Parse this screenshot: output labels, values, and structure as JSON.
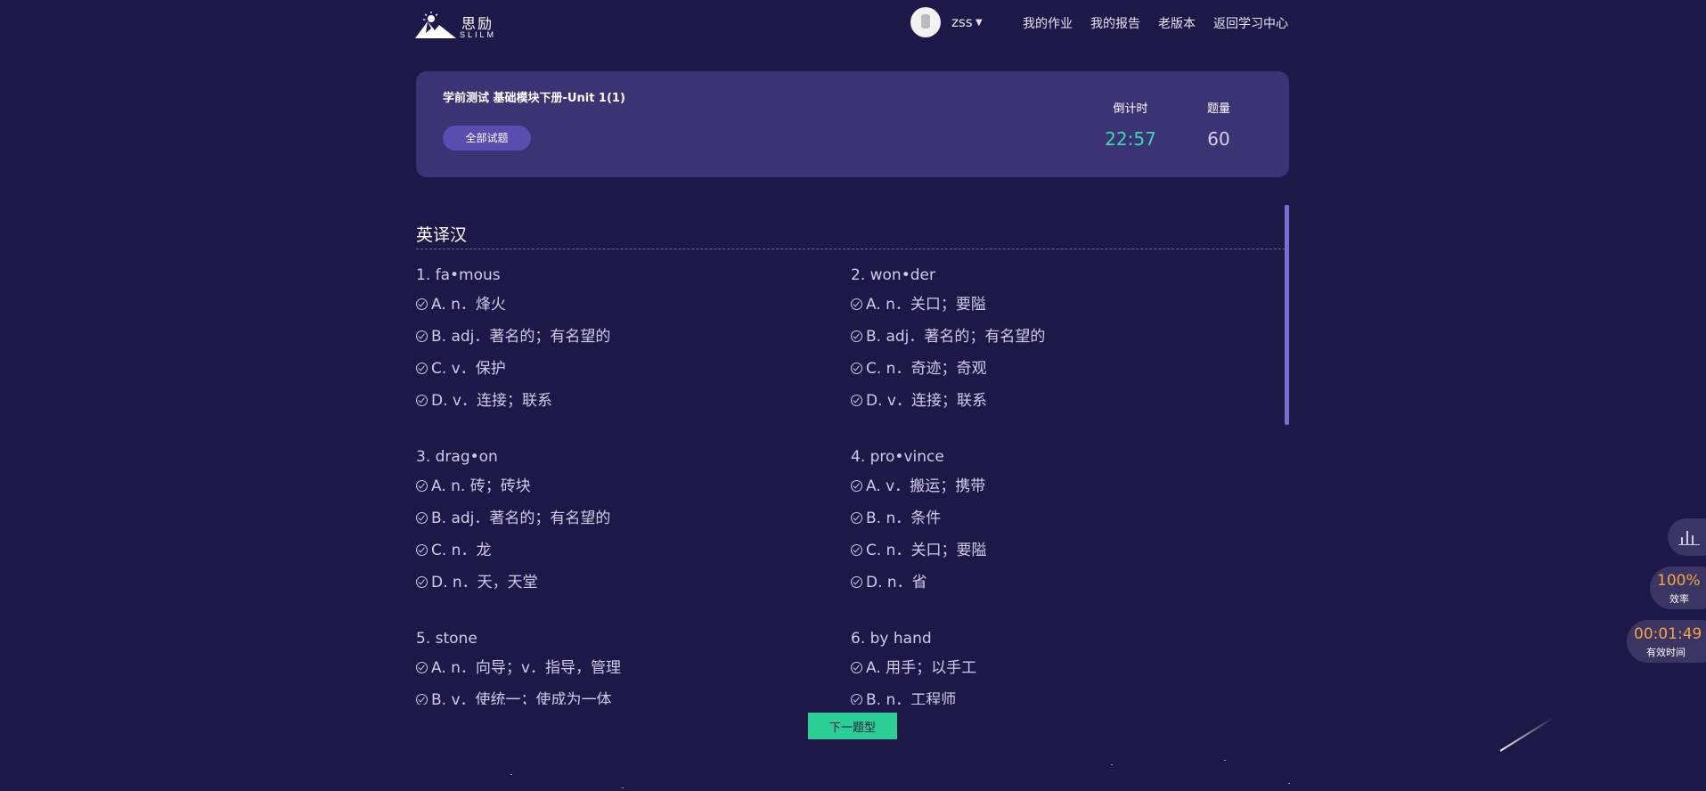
{
  "header": {
    "logo_cn": "思励",
    "logo_en": "SLILM",
    "username": "zss",
    "nav": [
      "我的作业",
      "我的报告",
      "老版本",
      "返回学习中心"
    ]
  },
  "test": {
    "title": "学前测试 基础模块下册-Unit 1(1)",
    "all_questions_button": "全部试题",
    "countdown_label": "倒计时",
    "countdown_value": "22:57",
    "count_label": "题量",
    "count_value": "60"
  },
  "section": {
    "title": "英译汉"
  },
  "questions": [
    {
      "head": "1. fa•mous",
      "options": [
        "A. n．烽火",
        "B. adj．著名的；有名望的",
        "C. v．保护",
        "D. v．连接；联系"
      ]
    },
    {
      "head": "2. won•der",
      "options": [
        "A. n．关口；要隘",
        "B. adj．著名的；有名望的",
        "C. n．奇迹；奇观",
        "D. v．连接；联系"
      ]
    },
    {
      "head": "3. drag•on",
      "options": [
        "A. n. 砖；砖块",
        "B. adj．著名的；有名望的",
        "C. n．龙",
        "D. n．天，天堂"
      ]
    },
    {
      "head": "4. pro•vince",
      "options": [
        "A. v．搬运；携带",
        "B. n．条件",
        "C. n．关口；要隘",
        "D. n．省"
      ]
    },
    {
      "head": "5. stone",
      "options": [
        "A. n．向导；v．指导，管理",
        "B. v．使统一；使成为一体"
      ]
    },
    {
      "head": "6. by hand",
      "options": [
        "A. 用手；以手工",
        "B. n．工程师"
      ]
    }
  ],
  "next_button": "下一题型",
  "widgets": {
    "chart_icon": "bar-chart-icon",
    "efficiency_value": "100%",
    "efficiency_label": "效率",
    "time_value": "00:01:49",
    "time_label": "有效时间"
  },
  "colors": {
    "background": "#1e1848",
    "card": "#3b3373",
    "countdown": "#3fd6b0",
    "accent_orange": "#f7a440",
    "next_button": "#2bcf95"
  }
}
